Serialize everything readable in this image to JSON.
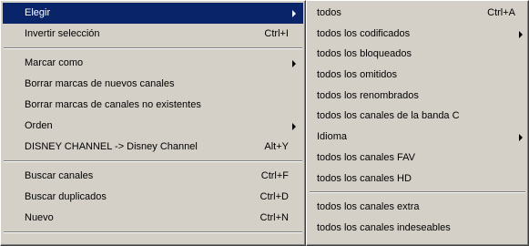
{
  "main_menu": {
    "items": [
      {
        "label": "Elegir",
        "shortcut": "",
        "submenu": true
      },
      {
        "label": "Invertir selección",
        "shortcut": "Ctrl+I"
      },
      {
        "label": "Marcar como",
        "shortcut": "",
        "submenu": true
      },
      {
        "label": "Borrar marcas de nuevos canales",
        "shortcut": ""
      },
      {
        "label": "Borrar marcas de canales no existentes",
        "shortcut": ""
      },
      {
        "label": "Orden",
        "shortcut": "",
        "submenu": true
      },
      {
        "label": "DISNEY CHANNEL -> Disney Channel",
        "shortcut": "Alt+Y"
      },
      {
        "label": "Buscar canales",
        "shortcut": "Ctrl+F"
      },
      {
        "label": "Buscar duplicados",
        "shortcut": "Ctrl+D"
      },
      {
        "label": "Nuevo",
        "shortcut": "Ctrl+N"
      }
    ]
  },
  "submenu": {
    "items": [
      {
        "label": "todos",
        "shortcut": "Ctrl+A"
      },
      {
        "label": "todos los codificados",
        "submenu": true
      },
      {
        "label": "todos los bloqueados"
      },
      {
        "label": "todos los omitidos"
      },
      {
        "label": "todos los renombrados"
      },
      {
        "label": "todos los canales de la banda C"
      },
      {
        "label": "Idioma",
        "submenu": true
      },
      {
        "label": "todos los canales FAV"
      },
      {
        "label": "todos los canales HD"
      },
      {
        "label": "todos los canales extra"
      },
      {
        "label": "todos los canales indeseables"
      }
    ]
  },
  "colors": {
    "menu_background": "#d4d0c8",
    "highlight": "#0a246a",
    "highlight_text": "#ffffff"
  }
}
